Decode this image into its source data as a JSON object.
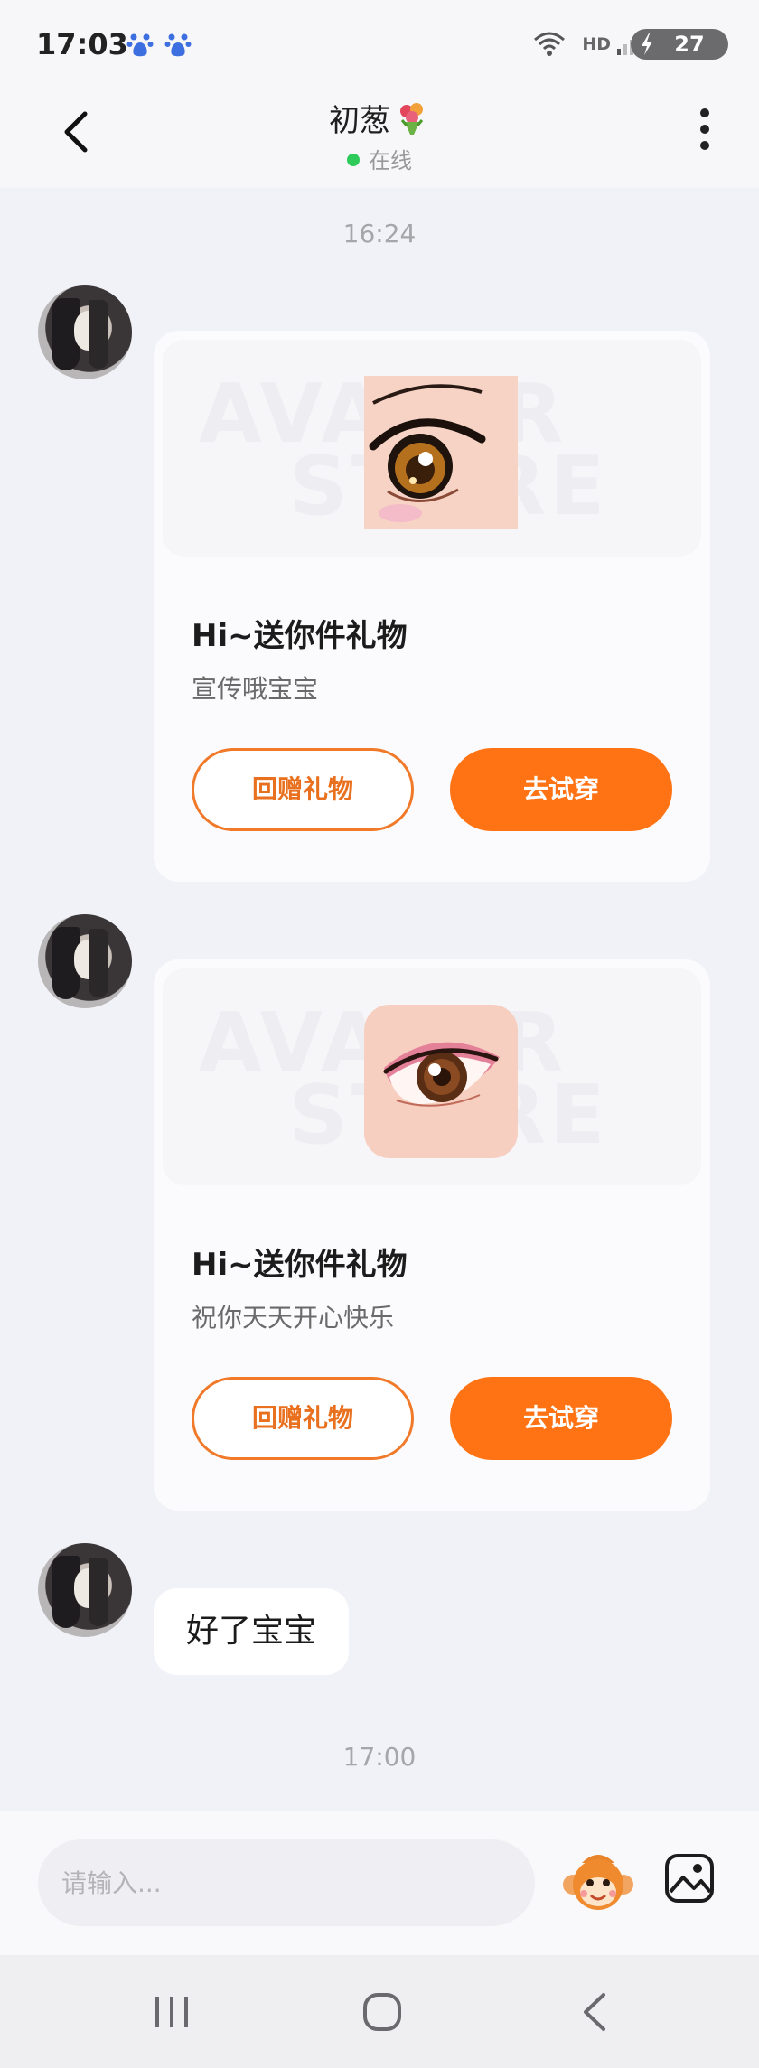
{
  "status_bar": {
    "time": "17:03",
    "network": "HD",
    "battery": "27",
    "icons": [
      "baidu-paw-icon",
      "baidu-paw-icon",
      "wifi-icon",
      "signal-icon",
      "battery-charging-icon"
    ]
  },
  "header": {
    "contact_name": "初葱",
    "name_emoji": "flower-bouquet-icon",
    "status": "在线",
    "status_color": "#2ecb5a"
  },
  "chat": {
    "timestamps": [
      "16:24",
      "17:00"
    ],
    "gift_cards": [
      {
        "title": "Hi~送你件礼物",
        "message": "宣传哦宝宝",
        "item": "anime-eye-gift",
        "return_label": "回赠礼物",
        "try_label": "去试穿"
      },
      {
        "title": "Hi~送你件礼物",
        "message": "祝你天天开心快乐",
        "item": "pink-eyeshadow-gift",
        "return_label": "回赠礼物",
        "try_label": "去试穿"
      }
    ],
    "text_message": "好了宝宝",
    "watermark_top": "AVATAR",
    "watermark_bottom": "STORE"
  },
  "input": {
    "placeholder": "请输入..."
  },
  "colors": {
    "accent": "#ff7314",
    "background": "#f1f2f7"
  }
}
